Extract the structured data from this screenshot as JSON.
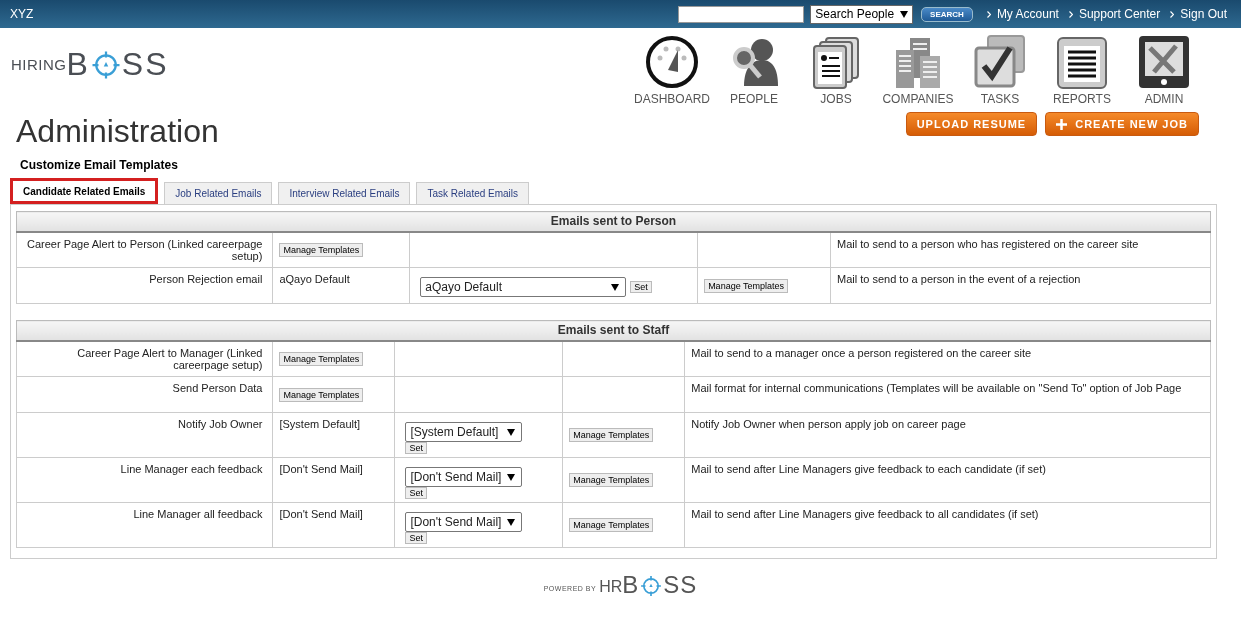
{
  "topbar": {
    "brand": "XYZ",
    "search_scope": "Search People",
    "search_button": "SEARCH",
    "links": [
      "My Account",
      "Support Center",
      "Sign Out"
    ]
  },
  "logo": {
    "prefix": "HIRING",
    "before": "B",
    "after": "SS"
  },
  "nav": [
    {
      "kind": "dashboard",
      "label": "DASHBOARD"
    },
    {
      "kind": "people",
      "label": "PEOPLE"
    },
    {
      "kind": "jobs",
      "label": "JOBS"
    },
    {
      "kind": "companies",
      "label": "COMPANIES"
    },
    {
      "kind": "tasks",
      "label": "TASKS"
    },
    {
      "kind": "reports",
      "label": "REPORTS"
    },
    {
      "kind": "admin",
      "label": "ADMIN"
    }
  ],
  "page_title": "Administration",
  "actions": [
    {
      "kind": "plain",
      "label": "UPLOAD RESUME"
    },
    {
      "kind": "plus",
      "label": "CREATE NEW JOB"
    }
  ],
  "section_title": "Customize Email Templates",
  "tabs": [
    {
      "label": "Candidate Related Emails",
      "selected": true
    },
    {
      "label": "Job Related Emails",
      "selected": false
    },
    {
      "label": "Interview Related Emails",
      "selected": false
    },
    {
      "label": "Task Related Emails",
      "selected": false
    }
  ],
  "sections": [
    {
      "title": "Emails sent to Person",
      "rows": [
        {
          "cells": [
            {
              "kind": "label",
              "text": "Career Page Alert to Person (Linked careerpage setup)"
            },
            {
              "kind": "button",
              "text": "Manage Templates"
            },
            {
              "kind": "empty"
            },
            {
              "kind": "empty"
            },
            {
              "kind": "text",
              "text": "Mail to send to a person who has registered on the career site"
            }
          ]
        },
        {
          "cells": [
            {
              "kind": "label",
              "text": "Person Rejection email"
            },
            {
              "kind": "text",
              "text": "aQayo Default"
            },
            {
              "kind": "select",
              "text": "aQayo Default",
              "set": "Set"
            },
            {
              "kind": "button",
              "text": "Manage Templates"
            },
            {
              "kind": "text",
              "text": "Mail to send to a person in the event of a rejection"
            }
          ]
        }
      ]
    },
    {
      "title": "Emails sent to Staff",
      "rows": [
        {
          "cells": [
            {
              "kind": "label",
              "text": "Career Page Alert to Manager (Linked careerpage setup)"
            },
            {
              "kind": "button",
              "text": "Manage Templates"
            },
            {
              "kind": "empty"
            },
            {
              "kind": "empty"
            },
            {
              "kind": "text",
              "text": "Mail to send to a manager once a person registered on the career site"
            }
          ]
        },
        {
          "cells": [
            {
              "kind": "label",
              "text": "Send Person Data"
            },
            {
              "kind": "button",
              "text": "Manage Templates"
            },
            {
              "kind": "empty"
            },
            {
              "kind": "empty"
            },
            {
              "kind": "text",
              "text": "Mail format for internal communications (Templates will be available on \"Send To\" option of Job Page"
            }
          ]
        },
        {
          "cells": [
            {
              "kind": "label",
              "text": "Notify Job Owner"
            },
            {
              "kind": "text",
              "text": "[System Default]"
            },
            {
              "kind": "select",
              "text": "[System Default]",
              "set": "Set"
            },
            {
              "kind": "button",
              "text": "Manage Templates"
            },
            {
              "kind": "text",
              "text": "Notify Job Owner when person apply job on career page"
            }
          ]
        },
        {
          "cells": [
            {
              "kind": "label",
              "text": "Line Manager each feedback"
            },
            {
              "kind": "text",
              "text": "[Don't Send Mail]"
            },
            {
              "kind": "select",
              "text": "[Don't Send Mail]",
              "set": "Set"
            },
            {
              "kind": "button",
              "text": "Manage Templates"
            },
            {
              "kind": "text",
              "text": "Mail to send after Line Managers give feedback to each candidate (if set)"
            }
          ]
        },
        {
          "cells": [
            {
              "kind": "label",
              "text": "Line Manager all feedback"
            },
            {
              "kind": "text",
              "text": "[Don't Send Mail]"
            },
            {
              "kind": "select",
              "text": "[Don't Send Mail]",
              "set": "Set"
            },
            {
              "kind": "button",
              "text": "Manage Templates"
            },
            {
              "kind": "text",
              "text": "Mail to send after Line Managers give feedback to all candidates (if set)"
            }
          ]
        }
      ]
    }
  ],
  "footer": {
    "powered": "POWERED BY",
    "prefix": "HR",
    "before": "B",
    "after": "SS"
  }
}
